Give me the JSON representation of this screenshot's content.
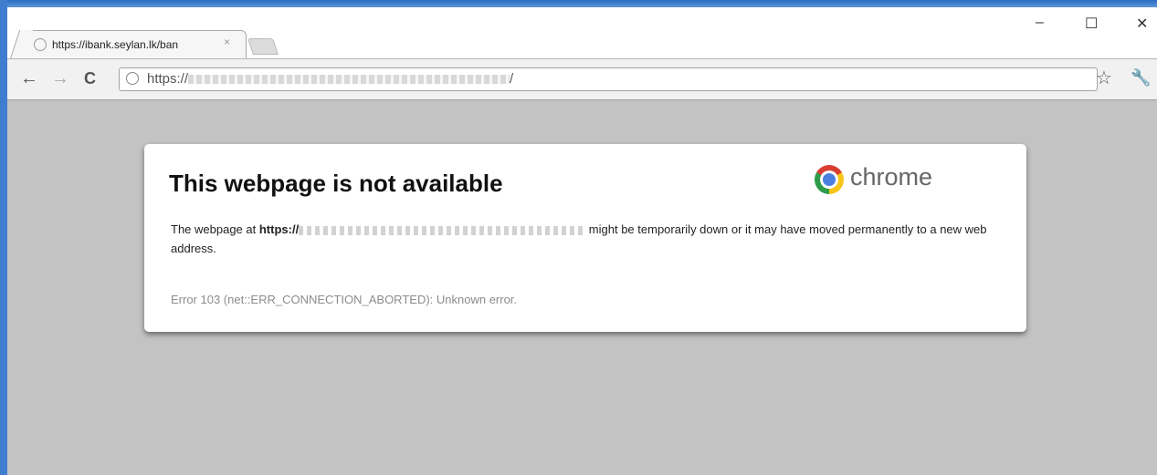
{
  "tab": {
    "title": "https://ibank.seylan.lk/ban",
    "close": "×",
    "favicon": "globe-icon"
  },
  "window_controls": {
    "minimize": "–",
    "maximize": "☐",
    "close": "✕"
  },
  "toolbar": {
    "back": "←",
    "forward": "→",
    "reload": "C",
    "star": "☆",
    "wrench": "🔧"
  },
  "omnibox": {
    "url_prefix": "https://",
    "url_suffix": "/"
  },
  "error_page": {
    "title": "This webpage is not available",
    "brand": "chrome",
    "message_pre": "The webpage at ",
    "message_url": "https://",
    "message_post": " might be temporarily down or it may have moved permanently to a new web address.",
    "error_detail": "Error 103 (net::ERR_CONNECTION_ABORTED): Unknown error."
  },
  "colors": {
    "content_bg": "#c3c3c3",
    "card_bg": "#ffffff",
    "window_border": "#3f7ecf"
  }
}
